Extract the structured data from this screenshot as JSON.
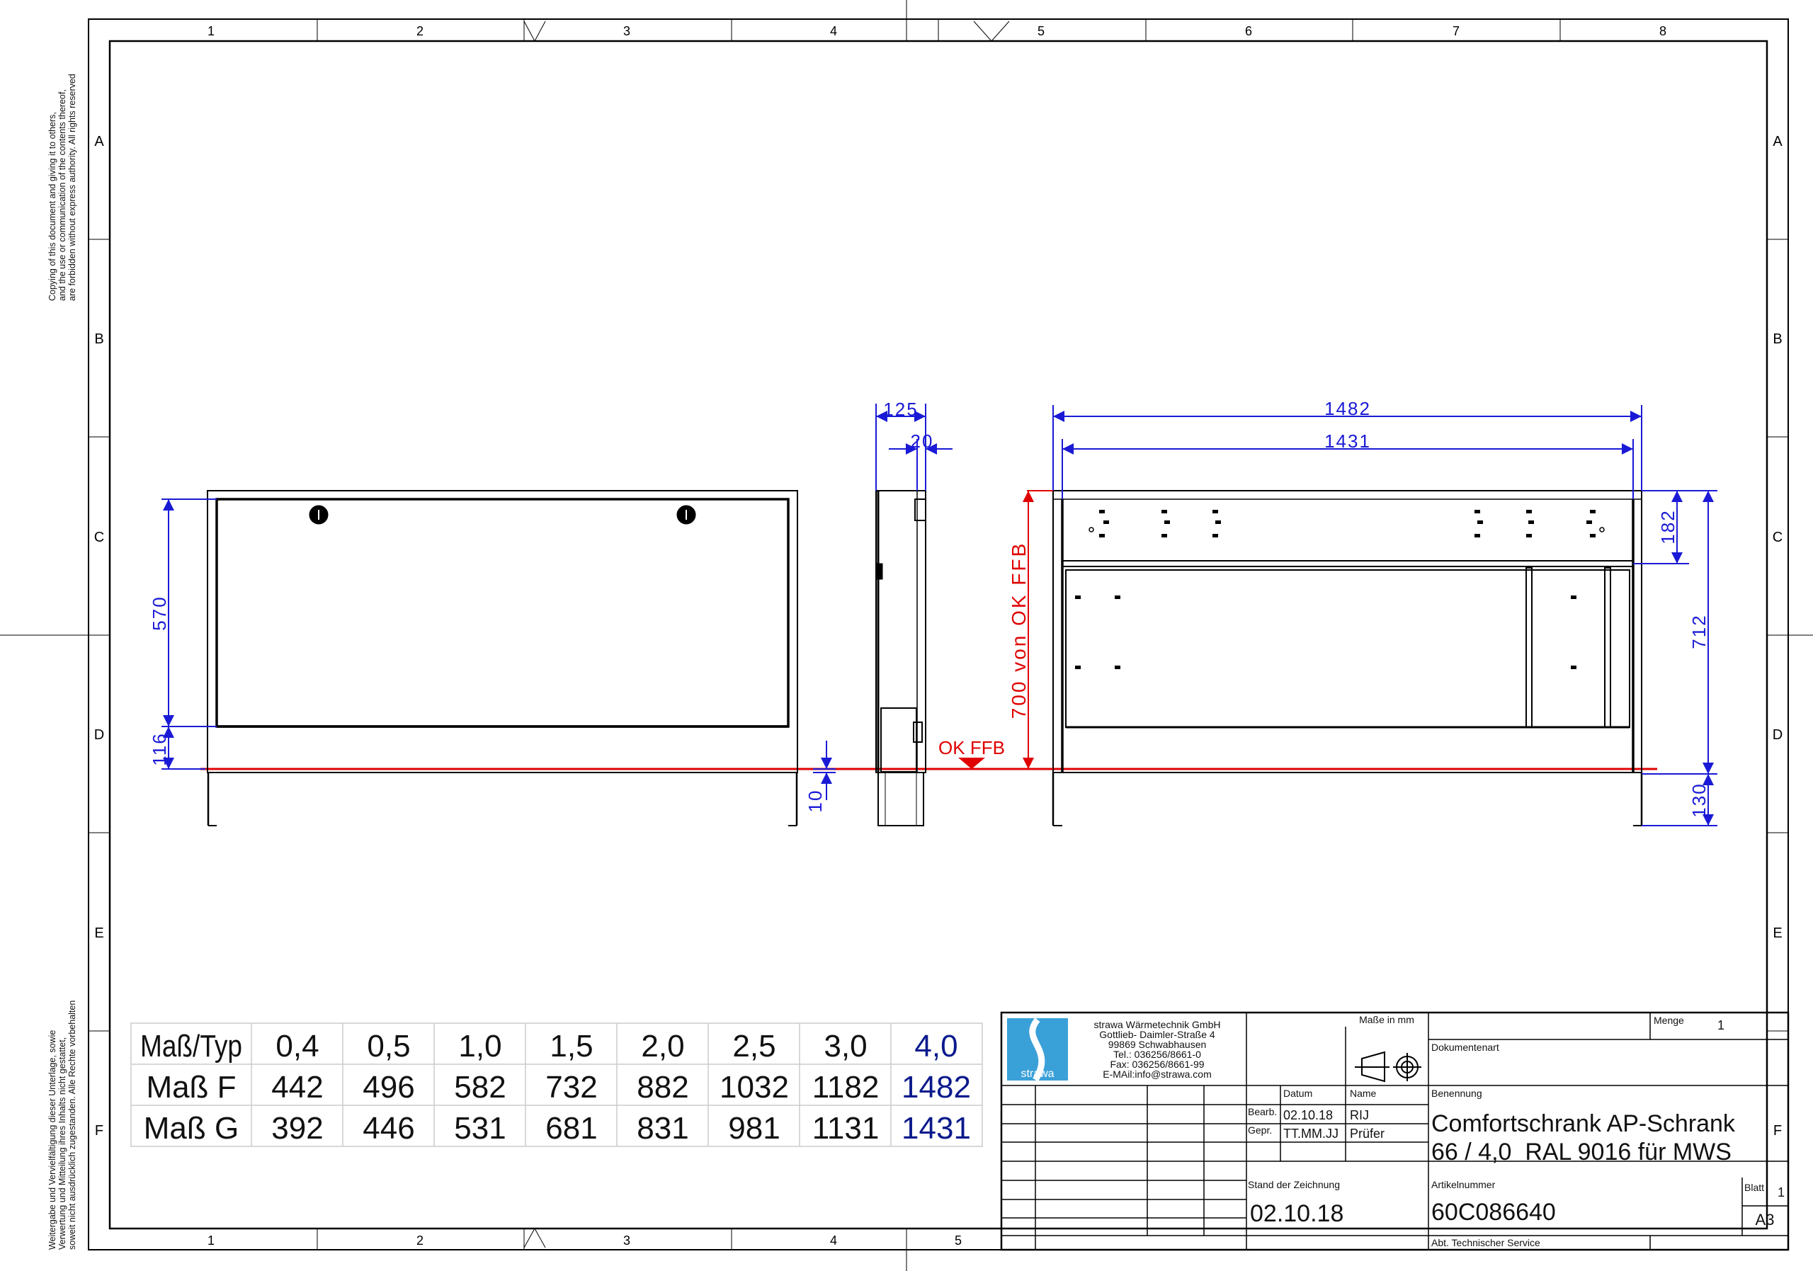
{
  "frame": {
    "columns": [
      "1",
      "2",
      "3",
      "4",
      "5",
      "6",
      "7",
      "8"
    ],
    "rows": [
      "A",
      "B",
      "C",
      "D",
      "E",
      "F"
    ],
    "bottom_columns": [
      "1",
      "2",
      "3",
      "4",
      "5"
    ]
  },
  "notices": {
    "copyright_en": [
      "Copying of this document and giving it to others,",
      "and the use or communication of the contents thereof,",
      "are forbidden without express authority. All rights reserved"
    ],
    "copyright_de": [
      "Weitergabe und Vervielfältigung dieser Unterlage, sowie",
      "Verwertung und Mitteilung ihres Inhalts nicht gestattet,",
      "soweit nicht ausdrücklich zugestanden. Alle Rechte vorbehalten"
    ]
  },
  "dimensions": {
    "front_height": "570",
    "front_bottom": "116",
    "foot_gap": "10",
    "side_depth": "125",
    "side_door": "20",
    "width_f": "1482",
    "width_g": "1431",
    "height_from_floor": "700 von OK FFB",
    "floor_label": "OK FFB",
    "top_section": "182",
    "total_height": "712",
    "foot_height": "130"
  },
  "size_table": {
    "header": [
      "Maß/Typ",
      "0,4",
      "0,5",
      "1,0",
      "1,5",
      "2,0",
      "2,5",
      "3,0",
      "4,0"
    ],
    "rows": [
      [
        "Maß F",
        "442",
        "496",
        "582",
        "732",
        "882",
        "1032",
        "1182",
        "1482"
      ],
      [
        "Maß G",
        "392",
        "446",
        "531",
        "681",
        "831",
        "981",
        "1131",
        "1431"
      ]
    ]
  },
  "title_block": {
    "logo_text": "strawa",
    "company_lines": [
      "strawa Wärmetechnik GmbH",
      "Gottlieb- Daimler-Straße 4",
      "99869 Schwabhausen",
      "Tel.: 036256/8661-0",
      "Fax: 036256/8661-99",
      "E-MAil:info@strawa.com"
    ],
    "units_label": "Maße in mm",
    "menge_label": "Menge",
    "menge_value": "1",
    "dokumentenart_label": "Dokumentenart",
    "datum_label": "Datum",
    "name_label": "Name",
    "bearb_label": "Bearb.",
    "bearb_date": "02.10.18",
    "bearb_name": "RIJ",
    "gepr_label": "Gepr.",
    "gepr_date": "TT.MM.JJ",
    "gepr_name": "Prüfer",
    "benennung_label": "Benennung",
    "title_line1": "Comfortschrank AP-Schrank",
    "title_line2": "66 / 4,0  RAL 9016 für MWS",
    "stand_label": "Stand der Zeichnung",
    "stand_value": "02.10.18",
    "artikel_label": "Artikelnummer",
    "artikel_value": "60C086640",
    "blatt_label": "Blatt",
    "blatt_value": "1",
    "format_value": "A3",
    "dept": "Abt. Technischer Service"
  },
  "colors": {
    "dimension": "#1a1ad6",
    "floor_line": "#e00000",
    "table_highlight": "#0b1a8c"
  }
}
